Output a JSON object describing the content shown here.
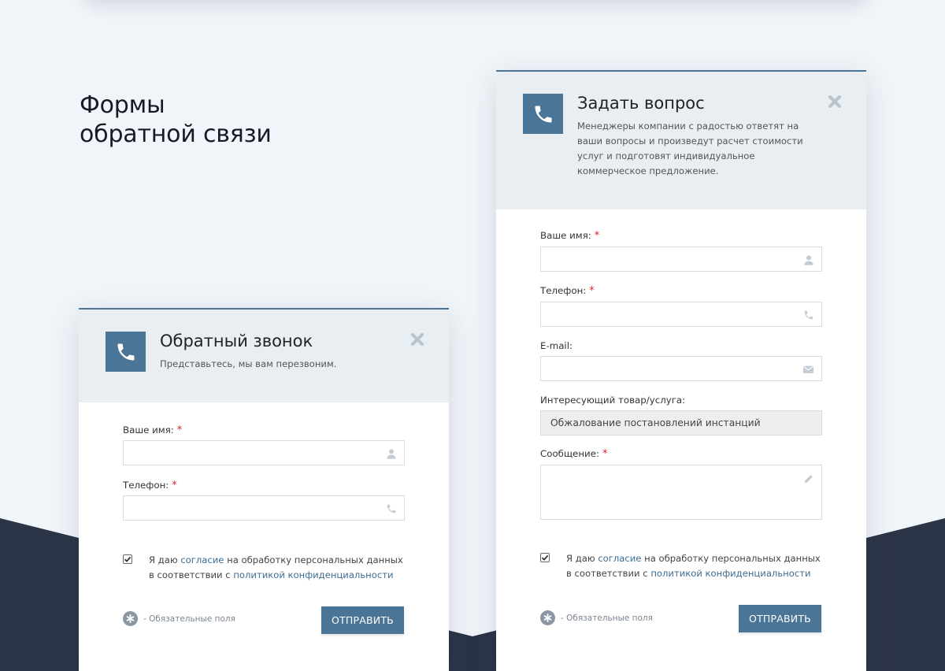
{
  "page": {
    "heading_line1": "Формы",
    "heading_line2": "обратной связи"
  },
  "colors": {
    "accent": "#4a7597",
    "background": "#f0f5f9",
    "dark_band": "#2c3547",
    "required_star": "#d8222a",
    "link": "#3e6d92"
  },
  "callback_form": {
    "title": "Обратный звонок",
    "subtitle": "Представьтесь, мы вам перезвоним.",
    "name_label": "Ваше имя:",
    "name_value": "",
    "phone_label": "Телефон:",
    "phone_value": "",
    "required_mark": "*",
    "consent_prefix": "Я даю ",
    "consent_link": "согласие",
    "consent_middle": " на обработку персональных данных в соответствии с ",
    "policy_link": "политикой конфиденциальности",
    "required_note": "- Обязательные поля",
    "submit_label": "ОТПРАВИТЬ"
  },
  "question_form": {
    "title": "Задать вопрос",
    "subtitle": "Менеджеры компании с радостью ответят на ваши вопросы и произведут расчет стоимости услуг и подготовят индивидуальное коммерческое предложение.",
    "name_label": "Ваше имя:",
    "name_value": "",
    "phone_label": "Телефон:",
    "phone_value": "",
    "email_label": "E-mail:",
    "email_value": "",
    "product_label": "Интересующий товар/услуга:",
    "product_value": "Обжалование постановлений инстанций",
    "message_label": "Сообщение:",
    "message_value": "",
    "required_mark": "*",
    "consent_prefix": "Я даю ",
    "consent_link": "согласие",
    "consent_middle": " на обработку персональных данных в соответствии с ",
    "policy_link": "политикой конфиденциальности",
    "required_note": "- Обязательные поля",
    "submit_label": "ОТПРАВИТЬ"
  },
  "icons": {
    "phone": "phone-icon",
    "close": "close-icon",
    "user": "user-icon",
    "phone_small": "phone-small-icon",
    "email": "envelope-icon",
    "pencil": "pencil-icon",
    "checkbox": "checkbox-checked-icon",
    "asterisk": "asterisk-icon"
  }
}
